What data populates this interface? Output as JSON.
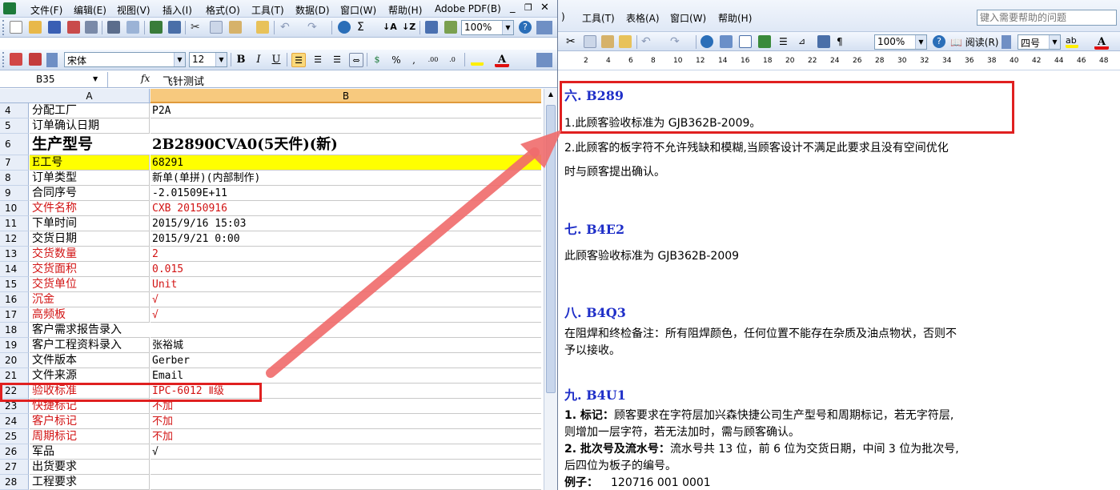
{
  "excel": {
    "menu": [
      "文件(F)",
      "编辑(E)",
      "视图(V)",
      "插入(I)",
      "格式(O)",
      "工具(T)",
      "数据(D)",
      "窗口(W)",
      "帮助(H)",
      "Adobe PDF(B)"
    ],
    "zoom": "100%",
    "font_name": "宋体",
    "font_size": "12",
    "name_box": "B35",
    "fx": "fx",
    "formula": "飞针测试",
    "col_a": "A",
    "col_b": "B",
    "rows": [
      {
        "n": "4",
        "a": "分配工厂",
        "b": "P2A"
      },
      {
        "n": "5",
        "a": "订单确认日期",
        "b": ""
      },
      {
        "n": "6",
        "a": "生产型号",
        "b": "2B2890CVA0(5天件)(新)"
      },
      {
        "n": "7",
        "a": "E工号",
        "b": "68291"
      },
      {
        "n": "8",
        "a": "订单类型",
        "b": "新单(单拼)(内部制作)"
      },
      {
        "n": "9",
        "a": "合同序号",
        "b": "-2.01509E+11"
      },
      {
        "n": "10",
        "a": "文件名称",
        "b": "CXB 20150916"
      },
      {
        "n": "11",
        "a": "下单时间",
        "b": "2015/9/16 15:03"
      },
      {
        "n": "12",
        "a": "交货日期",
        "b": "2015/9/21 0:00"
      },
      {
        "n": "13",
        "a": "交货数量",
        "b": "2"
      },
      {
        "n": "14",
        "a": "交货面积",
        "b": "0.015"
      },
      {
        "n": "15",
        "a": "交货单位",
        "b": "Unit"
      },
      {
        "n": "16",
        "a": "沉金",
        "b": "√"
      },
      {
        "n": "17",
        "a": "高频板",
        "b": "√"
      },
      {
        "n": "18",
        "a": "客户需求报告录入",
        "b": ""
      },
      {
        "n": "19",
        "a": "客户工程资料录入",
        "b": "张裕城"
      },
      {
        "n": "20",
        "a": "文件版本",
        "b": "Gerber"
      },
      {
        "n": "21",
        "a": "文件来源",
        "b": "Email"
      },
      {
        "n": "22",
        "a": "验收标准",
        "b": "IPC-6012 Ⅱ级"
      },
      {
        "n": "23",
        "a": "快捷标记",
        "b": "不加"
      },
      {
        "n": "24",
        "a": "客户标记",
        "b": "不加"
      },
      {
        "n": "25",
        "a": "周期标记",
        "b": "不加"
      },
      {
        "n": "26",
        "a": "军品",
        "b": "√"
      },
      {
        "n": "27",
        "a": "出货要求",
        "b": ""
      },
      {
        "n": "28",
        "a": "工程要求",
        "b": ""
      }
    ]
  },
  "word": {
    "menu": [
      "工具(T)",
      "表格(A)",
      "窗口(W)",
      "帮助(H)"
    ],
    "help_placeholder": "键入需要帮助的问题",
    "zoom": "100%",
    "read_label": "阅读(R)",
    "font_size": "四号",
    "ruler": [
      "2",
      "4",
      "6",
      "8",
      "10",
      "12",
      "14",
      "16",
      "18",
      "20",
      "22",
      "24",
      "26",
      "28",
      "30",
      "32",
      "34",
      "36",
      "38",
      "40",
      "42",
      "44",
      "46",
      "48"
    ],
    "s6_title": "六. B289",
    "s6_l1": "1.此顾客验收标准为 GJB362B-2009。",
    "s6_l2": "2.此顾客的板字符不允许残缺和模糊,当顾客设计不满足此要求且没有空间优化",
    "s6_l3": "时与顾客提出确认。",
    "s7_title": "七. B4E2",
    "s7_l1": "此顾客验收标准为 GJB362B-2009",
    "s8_title": "八. B4Q3",
    "s8_l1": "在阻焊和终检备注：所有阻焊颜色，任何位置不能存在杂质及油点物状，否则不",
    "s8_l2": "予以接收。",
    "s9_title": "九. B4U1",
    "s9_l1_bold": "1. 标记：",
    "s9_l1": "顾客要求在字符层加兴森快捷公司生产型号和周期标记，若无字符层,",
    "s9_l2": "则增加一层字符，若无法加时，需与顾客确认。",
    "s9_l3_bold": "2. 批次号及流水号：",
    "s9_l3": "流水号共 13 位，前 6 位为交货日期，中间 3 位为批次号,",
    "s9_l4": "后四位为板子的编号。",
    "s9_l5_bold": "例子：",
    "s9_l5": "120716 001 0001"
  },
  "colors": {
    "highlight_red": "#e02020",
    "yellow_row": "#ffff00",
    "word_heading": "#1f2fc8"
  }
}
